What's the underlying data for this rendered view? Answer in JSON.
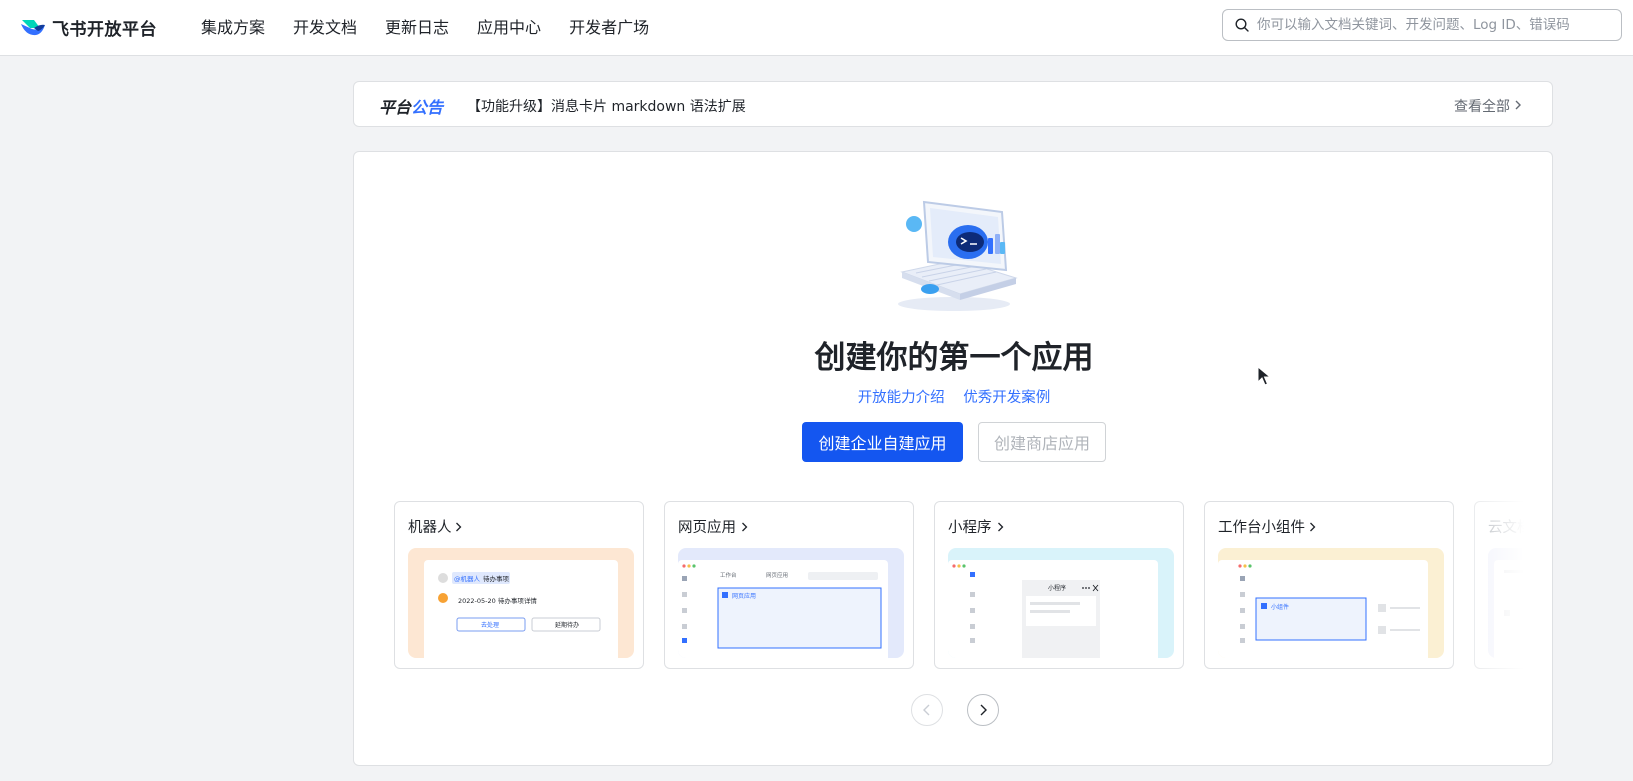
{
  "brand": {
    "name": "飞书开放平台",
    "logo_icon": "feishu-logo-icon"
  },
  "nav": {
    "items": [
      "集成方案",
      "开发文档",
      "更新日志",
      "应用中心",
      "开发者广场"
    ]
  },
  "search": {
    "placeholder": "你可以输入文档关键词、开发问题、Log ID、错误码",
    "icon": "search-icon"
  },
  "announcement": {
    "tag_part1": "平台",
    "tag_part2": "公告",
    "text": "【功能升级】消息卡片 markdown 语法扩展",
    "view_all": "查看全部"
  },
  "hero": {
    "title": "创建你的第一个应用",
    "link_capabilities": "开放能力介绍",
    "link_cases": "优秀开发案例",
    "primary_button": "创建企业自建应用",
    "secondary_button": "创建商店应用"
  },
  "app_types": [
    {
      "title": "机器人",
      "tint": "#fde7d3"
    },
    {
      "title": "网页应用",
      "tint": "#e3e9fb"
    },
    {
      "title": "小程序",
      "tint": "#d9f3fa"
    },
    {
      "title": "工作台小组件",
      "tint": "#fbf0d3"
    },
    {
      "title": "云文档小组件",
      "tint": "#eceefa"
    }
  ],
  "previews": {
    "bot_mention": "@机器人",
    "bot_todo": "待办事项",
    "bot_date": "2022-05-20 待办事项详情",
    "bot_btn1": "去处理",
    "bot_btn2": "延期待办",
    "web_tab1": "工作台",
    "web_tab2": "网页应用",
    "web_label": "网页应用",
    "mini_title": "小程序",
    "widget_label": "小组件"
  },
  "carousel": {
    "prev_icon": "chevron-left-icon",
    "next_icon": "chevron-right-icon",
    "prev_disabled": true
  }
}
